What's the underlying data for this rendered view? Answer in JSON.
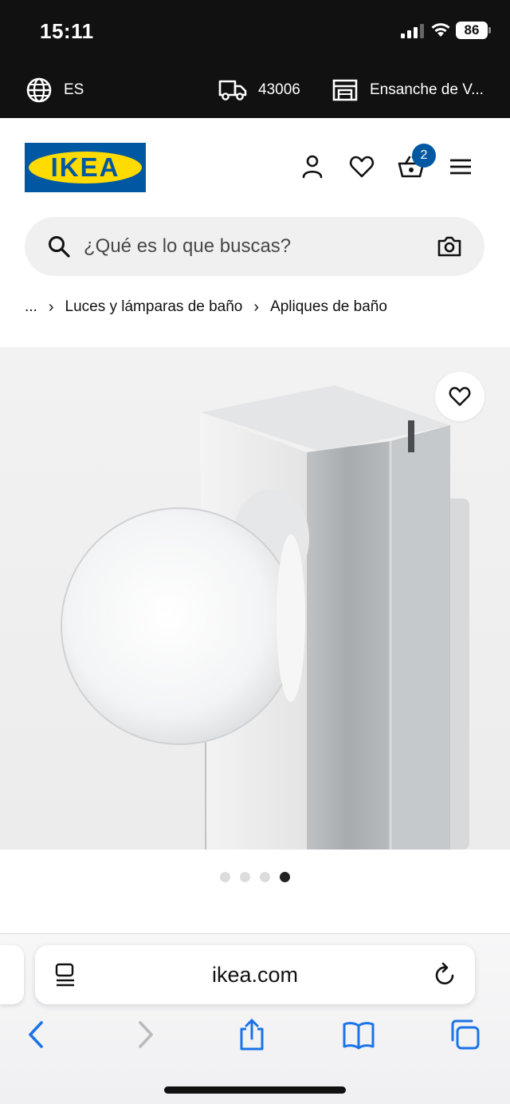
{
  "status_bar": {
    "time": "15:11",
    "battery": "86"
  },
  "location_bar": {
    "language": "ES",
    "postal_code": "43006",
    "store": "Ensanche de V..."
  },
  "header": {
    "logo_text": "IKEA",
    "cart_count": "2"
  },
  "search": {
    "placeholder": "¿Qué es lo que buscas?"
  },
  "breadcrumb": {
    "ellipsis": "...",
    "items": [
      "Luces y lámparas de baño",
      "Apliques de baño"
    ]
  },
  "carousel": {
    "total": 4,
    "active_index": 3
  },
  "browser": {
    "url": "ikea.com"
  },
  "colors": {
    "ikea_blue": "#0058a3",
    "ikea_yellow": "#ffdb00",
    "ios_blue": "#1a73e8"
  }
}
